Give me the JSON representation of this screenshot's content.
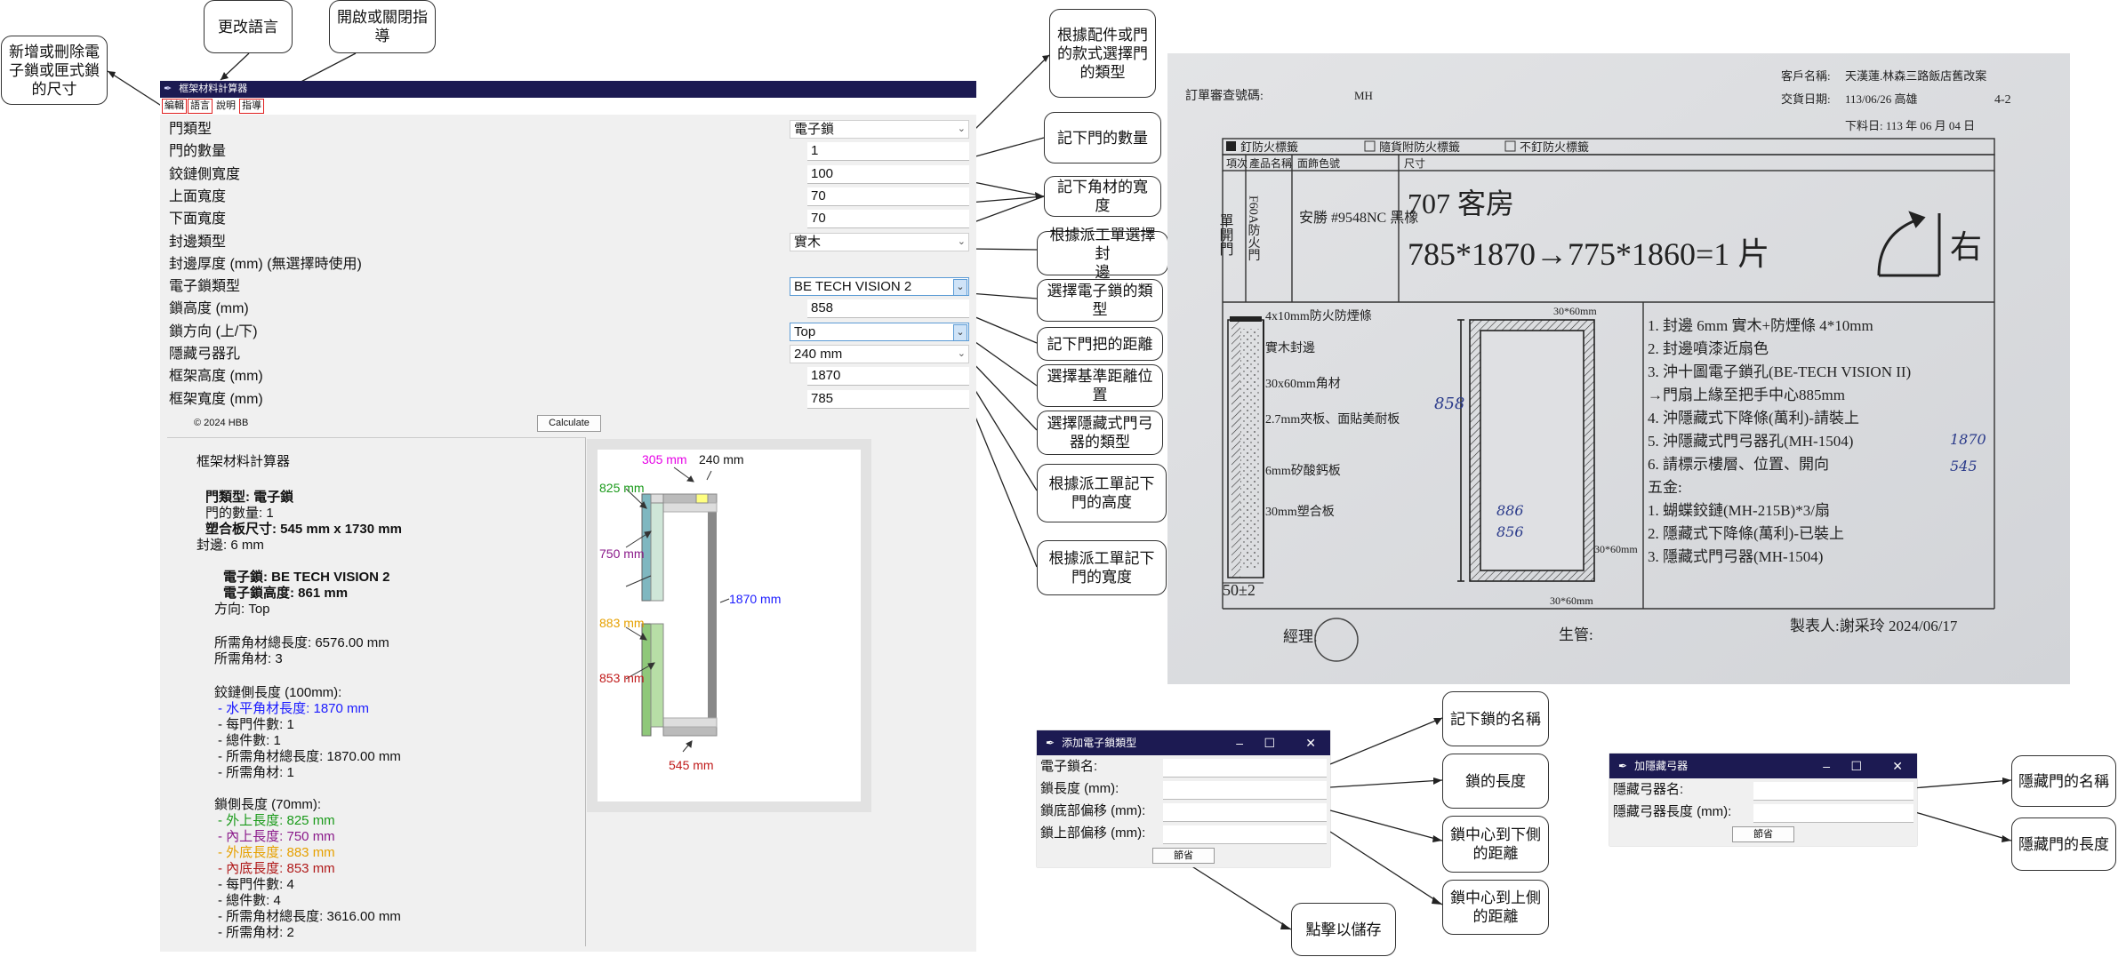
{
  "callouts": {
    "add_delete_lock": "新增或刪除電\n子鎖或匣式鎖\n的尺寸",
    "change_language": "更改語言",
    "toggle_guide": "開啟或關閉指\n導",
    "door_type": "根據配件或門\n的款式選擇門\n的類型",
    "door_count": "記下門的數量",
    "frame_width": "記下角材的寬度",
    "edge_type": "根據派工單選擇封\n邊",
    "lock_type": "選擇電子鎖的類\n型",
    "handle_distance": "記下門把的距離",
    "reference_position": "選擇基準距離位\n置",
    "closer_type": "選擇隱藏式門弓\n器的類型",
    "door_height": "根據派工單記下\n門的高度",
    "door_width": "根據派工單記下\n門的寬度",
    "lock_name": "記下鎖的名稱",
    "lock_length": "鎖的長度",
    "lock_bottom": "鎖中心到下側\n的距離",
    "lock_top": "鎖中心到上側\n的距離",
    "click_save": "點擊以儲存",
    "closer_name": "隱藏門的名稱",
    "closer_length": "隱藏門的長度"
  },
  "app": {
    "title": "框架材料計算器",
    "menu": [
      "編輯",
      "語言",
      "說明",
      "指導"
    ],
    "fields": [
      {
        "label": "門類型",
        "value": "電子鎖",
        "kind": "select"
      },
      {
        "label": "門的數量",
        "value": "1",
        "kind": "entry"
      },
      {
        "label": "鉸鏈側寬度",
        "value": "100",
        "kind": "entry"
      },
      {
        "label": "上面寬度",
        "value": "70",
        "kind": "entry"
      },
      {
        "label": "下面寬度",
        "value": "70",
        "kind": "entry"
      },
      {
        "label": "封邊類型",
        "value": "實木",
        "kind": "select"
      },
      {
        "label": "封邊厚度 (mm) (無選擇時使用)",
        "value": "",
        "kind": "none"
      },
      {
        "label": "電子鎖類型",
        "value": "BE TECH VISION 2",
        "kind": "select-hl"
      },
      {
        "label": "鎖高度 (mm)",
        "value": "858",
        "kind": "entry"
      },
      {
        "label": "鎖方向 (上/下)",
        "value": "Top",
        "kind": "select-hl"
      },
      {
        "label": "隱藏弓器孔",
        "value": "240 mm",
        "kind": "select"
      },
      {
        "label": "框架高度 (mm)",
        "value": "1870",
        "kind": "entry"
      },
      {
        "label": "框架寬度 (mm)",
        "value": "785",
        "kind": "entry"
      }
    ],
    "copyright": "© 2024 HBB",
    "calculate": "Calculate",
    "results": {
      "heading": "框架材料計算器",
      "door_type": "門類型: 電子鎖",
      "door_count": "門的數量: 1",
      "board_size": "塑合板尺寸: 545 mm x 1730 mm",
      "edge": "封邊: 6 mm",
      "lock": "電子鎖: BE TECH VISION 2",
      "lock_height": "電子鎖高度: 861 mm",
      "direction": "方向: Top",
      "total_len": "所需角材總長度: 6576.00 mm",
      "total_count": "所需角材: 3",
      "hinge_title": "鉸鏈側長度 (100mm):",
      "hinge_lines": [
        {
          "t": "- 水平角材長度: 1870 mm",
          "c": "#1a1aff"
        },
        {
          "t": "- 每門件數: 1",
          "c": "#111"
        },
        {
          "t": "- 總件數: 1",
          "c": "#111"
        },
        {
          "t": "- 所需角材總長度: 1870.00 mm",
          "c": "#111"
        },
        {
          "t": "- 所需角材: 1",
          "c": "#111"
        }
      ],
      "lock_title": "鎖側長度 (70mm):",
      "lock_lines": [
        {
          "t": "- 外上長度: 825 mm",
          "c": "#1a9a1a"
        },
        {
          "t": "- 內上長度: 750 mm",
          "c": "#8a1a8a"
        },
        {
          "t": "- 外底長度: 883 mm",
          "c": "#e6a000"
        },
        {
          "t": "- 內底長度: 853 mm",
          "c": "#b01a1a"
        },
        {
          "t": "- 每門件數: 4",
          "c": "#111"
        },
        {
          "t": "- 總件數: 4",
          "c": "#111"
        },
        {
          "t": "- 所需角材總長度: 3616.00 mm",
          "c": "#111"
        },
        {
          "t": "- 所需角材: 2",
          "c": "#111"
        }
      ]
    },
    "diagram": {
      "l305": "305 mm",
      "l240": "240 mm",
      "l825": "825 mm",
      "l750": "750 mm",
      "l883": "883 mm",
      "l853": "853 mm",
      "l1870": "1870 mm",
      "l545": "545 mm",
      "colors": {
        "magenta": "#e600e6",
        "green": "#1a9a1a",
        "purple": "#8a1a8a",
        "orange": "#e6a000",
        "red": "#c01a1a",
        "blue": "#1a1aff"
      }
    }
  },
  "lock_dialog": {
    "title": "添加電子鎖類型",
    "rows": [
      "電子鎖名:",
      "鎖長度 (mm):",
      "鎖底部偏移 (mm):",
      "鎖上部偏移 (mm):"
    ],
    "save": "節省"
  },
  "closer_dialog": {
    "title": "加隱藏弓器",
    "rows": [
      "隱藏弓器名:",
      "隱藏弓器長度 (mm):"
    ],
    "save": "節省"
  },
  "photo": {
    "order_no_label": "訂單審查號碼:",
    "order_no": "MH",
    "customer_label": "客戶名稱:",
    "customer": "天漢蓮.林森三路飯店舊改案",
    "delivery_label": "交貨日期:",
    "delivery": "113/06/26 高雄",
    "page": "4-2",
    "cut_date": "下料日: 113 年 06 月 04 日",
    "fire_labels": [
      "釘防火標籤",
      "隨貨附防火標籤",
      "不釘防火標籤"
    ],
    "col_headers": [
      "項次",
      "產品名稱",
      "面飾色號",
      "尺寸"
    ],
    "side_label": "單開門",
    "product": "F60A防火門",
    "finish": "安勝 #9548NC 黑橡",
    "room": "707 客房",
    "size": "785*1870→775*1860=1 片",
    "dir": "右",
    "section_labels": [
      "4x10mm防火防煙條",
      "實木封邊",
      "30x60mm角材",
      "2.7mm夾板、面貼美耐板",
      "6mm矽酸鈣板",
      "30mm塑合板"
    ],
    "dim_50": "50±2",
    "notes": [
      "1. 封邊 6mm 實木+防煙條 4*10mm",
      "2. 封邊噴漆近扇色",
      "3. 沖十圖電子鎖孔(BE-TECH VISION II)",
      "→門扇上緣至把手中心885mm",
      "4. 沖隱藏式下降條(萬利)-請裝上",
      "5. 沖隱藏式門弓器孔(MH-1504)",
      "6. 請標示樓層、位置、開向",
      "五金:",
      "1. 蝴蝶鉸鏈(MH-215B)*3/扇",
      "2. 隱藏式下降條(萬利)-已裝上",
      "3. 隱藏式門弓器(MH-1504)"
    ],
    "manager_label": "經理:",
    "supervisor_label": "生管:",
    "maker": "製表人:謝采玲 2024/06/17",
    "frame_dims": [
      "30*60mm",
      "30*60mm",
      "30*60mm"
    ],
    "hand_marks": [
      "858",
      "886",
      "856",
      "1870",
      "545"
    ]
  }
}
